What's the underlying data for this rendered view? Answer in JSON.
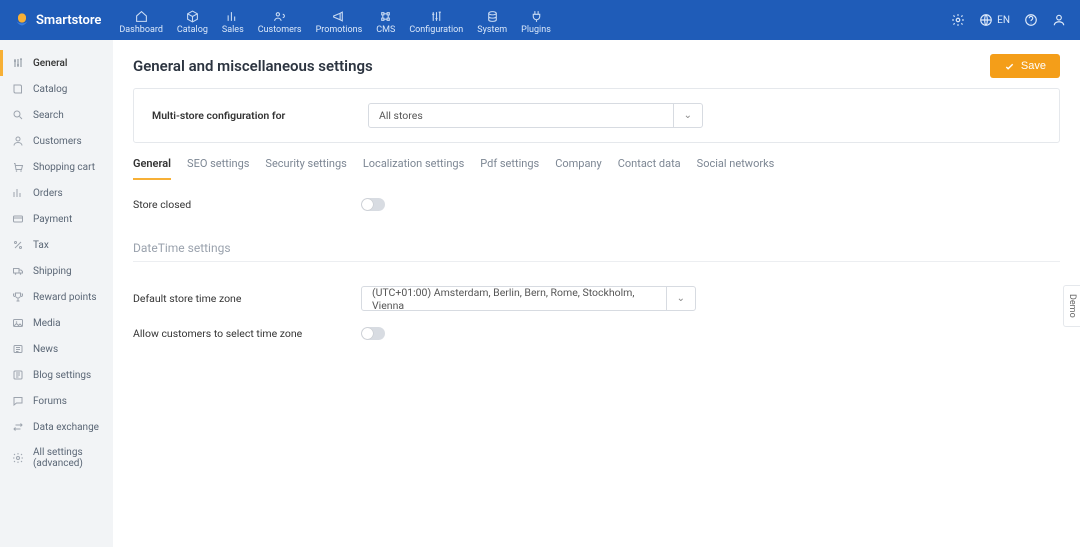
{
  "brand": "Smartstore",
  "topnav": [
    {
      "label": "Dashboard"
    },
    {
      "label": "Catalog"
    },
    {
      "label": "Sales"
    },
    {
      "label": "Customers"
    },
    {
      "label": "Promotions"
    },
    {
      "label": "CMS"
    },
    {
      "label": "Configuration"
    },
    {
      "label": "System"
    },
    {
      "label": "Plugins"
    }
  ],
  "lang": "EN",
  "sidebar": [
    {
      "label": "General",
      "active": true
    },
    {
      "label": "Catalog"
    },
    {
      "label": "Search"
    },
    {
      "label": "Customers"
    },
    {
      "label": "Shopping cart"
    },
    {
      "label": "Orders"
    },
    {
      "label": "Payment"
    },
    {
      "label": "Tax"
    },
    {
      "label": "Shipping"
    },
    {
      "label": "Reward points"
    },
    {
      "label": "Media"
    },
    {
      "label": "News"
    },
    {
      "label": "Blog settings"
    },
    {
      "label": "Forums"
    },
    {
      "label": "Data exchange"
    },
    {
      "label": "All settings (advanced)"
    }
  ],
  "page": {
    "title": "General and miscellaneous settings",
    "save": "Save",
    "multistore_label": "Multi-store configuration for",
    "multistore_value": "All stores"
  },
  "tabs": [
    {
      "label": "General",
      "active": true
    },
    {
      "label": "SEO settings"
    },
    {
      "label": "Security settings"
    },
    {
      "label": "Localization settings"
    },
    {
      "label": "Pdf settings"
    },
    {
      "label": "Company"
    },
    {
      "label": "Contact data"
    },
    {
      "label": "Social networks"
    }
  ],
  "form": {
    "store_closed_label": "Store closed",
    "store_closed": false,
    "datetime_section": "DateTime settings",
    "tz_label": "Default store time zone",
    "tz_value": "(UTC+01:00) Amsterdam, Berlin, Bern, Rome, Stockholm, Vienna",
    "allow_tz_label": "Allow customers to select time zone",
    "allow_tz": false
  },
  "demo": "Demo"
}
